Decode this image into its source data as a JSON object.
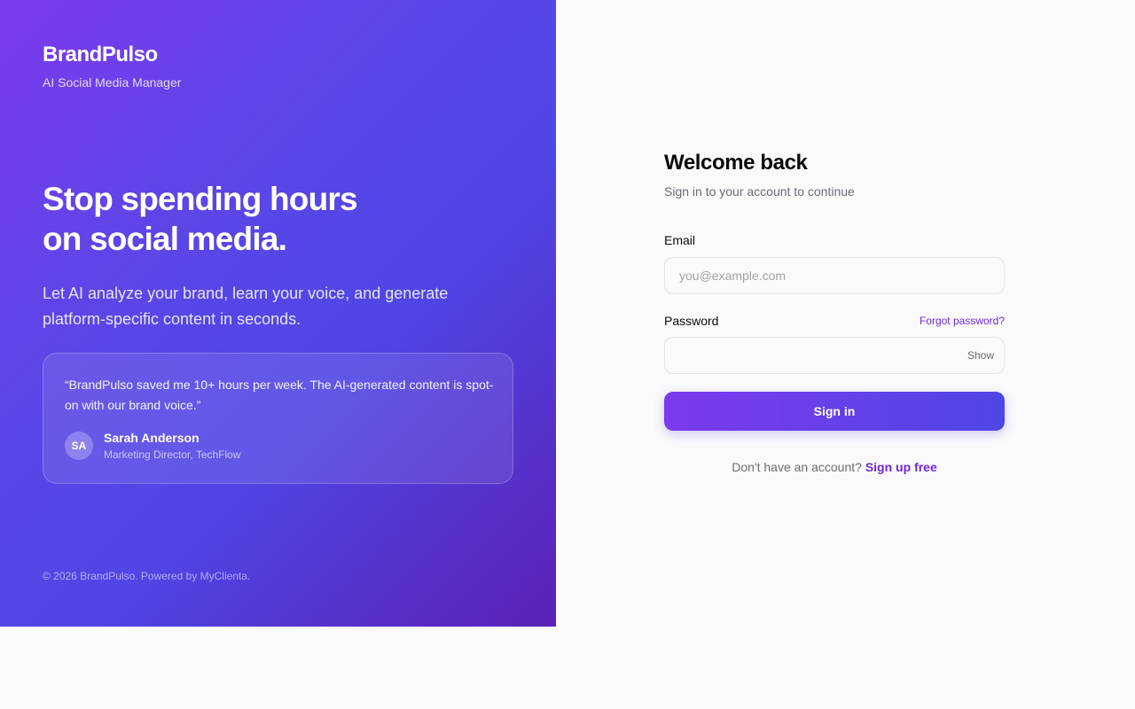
{
  "brand": {
    "name": "BrandPulso",
    "tagline": "AI Social Media Manager"
  },
  "hero": {
    "title_line1": "Stop spending hours",
    "title_line2": "on social media.",
    "subtitle": "Let AI analyze your brand, learn your voice, and generate platform-specific content in seconds."
  },
  "testimonial": {
    "quote": "“BrandPulso saved me 10+ hours per week. The AI-generated content is spot-on with our brand voice.”",
    "avatar_initials": "SA",
    "author_name": "Sarah Anderson",
    "author_role": "Marketing Director, TechFlow"
  },
  "footer": {
    "copyright": "© 2026 BrandPulso. Powered by MyClienta."
  },
  "login": {
    "title": "Welcome back",
    "subtitle": "Sign in to your account to continue",
    "email_label": "Email",
    "email_placeholder": "you@example.com",
    "email_value": "",
    "password_label": "Password",
    "password_value": "",
    "forgot_password": "Forgot password?",
    "show_toggle": "Show",
    "submit_label": "Sign in",
    "signup_prompt": "Don't have an account?",
    "signup_link": "Sign up free"
  },
  "colors": {
    "gradient_start": "#7c3aed",
    "gradient_end": "#4f46e5",
    "accent": "#6d28d9",
    "page_background": "#fafafa"
  }
}
